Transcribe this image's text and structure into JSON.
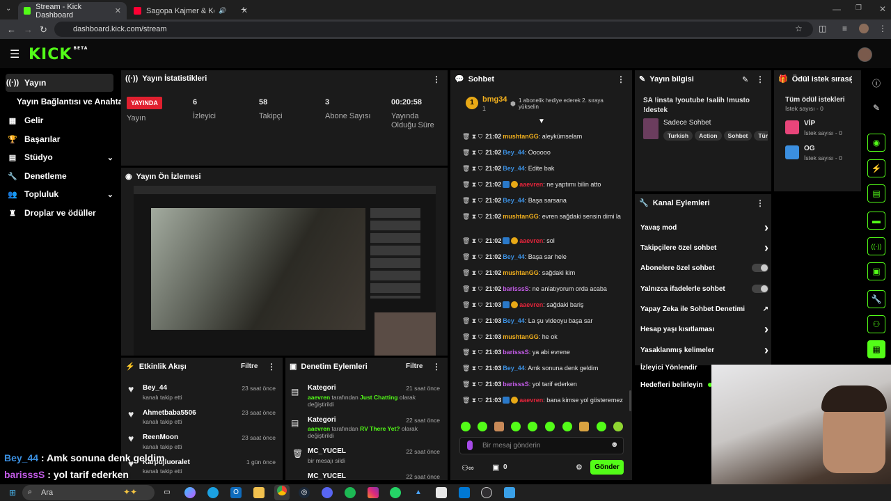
{
  "browser": {
    "tabs": [
      {
        "label": "Stream - Kick Dashboard",
        "active": true
      },
      {
        "label": "Sagopa Kajmer & Kolera - Ne",
        "active": false
      }
    ],
    "url": "dashboard.kick.com/stream"
  },
  "sidebar": {
    "items": [
      {
        "label": "Yayın",
        "icon": "broadcast-icon"
      },
      {
        "label": "Yayın Bağlantısı ve Anahtarı"
      },
      {
        "label": "Gelir",
        "icon": "revenue-icon"
      },
      {
        "label": "Başarılar",
        "icon": "trophy-icon"
      },
      {
        "label": "Stüdyo",
        "icon": "studio-icon"
      },
      {
        "label": "Denetleme",
        "icon": "wrench-icon"
      },
      {
        "label": "Topluluk",
        "icon": "community-icon"
      },
      {
        "label": "Droplar ve ödüller",
        "icon": "drops-icon"
      }
    ]
  },
  "stats": {
    "title": "Yayın İstatistikleri",
    "live_badge": "YAYINDA",
    "live_label": "Yayın",
    "items": [
      {
        "value": "6",
        "label": "İzleyici"
      },
      {
        "value": "58",
        "label": "Takipçi"
      },
      {
        "value": "3",
        "label": "Abone Sayısı"
      },
      {
        "value": "00:20:58",
        "label": "Yayında Olduğu Süre"
      }
    ]
  },
  "preview": {
    "title": "Yayın Ön İzlemesi"
  },
  "activity": {
    "title": "Etkinlik Akışı",
    "filter": "Filtre",
    "items": [
      {
        "name": "Bey_44",
        "sub": "kanalı takip etti",
        "time": "23 saat önce"
      },
      {
        "name": "Ahmetbaba5506",
        "sub": "kanalı takip etti",
        "time": "23 saat önce"
      },
      {
        "name": "ReenMoon",
        "sub": "kanalı takip etti",
        "time": "23 saat önce"
      },
      {
        "name": "Karpujluoralet",
        "sub": "kanalı takip etti",
        "time": "1 gün önce"
      }
    ]
  },
  "moderation": {
    "title": "Denetim Eylemleri",
    "filter": "Filtre",
    "items": [
      {
        "title": "Kategori",
        "time": "21 saat önce",
        "user": "aaevren",
        "mid": " tarafından ",
        "cat": "Just Chatting",
        "end": " olarak değiştirildi"
      },
      {
        "title": "Kategori",
        "time": "22 saat önce",
        "user": "aaevren",
        "mid": " tarafından ",
        "cat": "RV There Yet?",
        "end": " olarak değiştirildi"
      },
      {
        "title": "MC_YUCEL",
        "time": "22 saat önce",
        "sub": "bir mesajı sildi"
      },
      {
        "title": "MC_YUCEL",
        "time": "22 saat önce"
      }
    ]
  },
  "chat": {
    "title": "Sohbet",
    "pinned_user": "bmg34",
    "pinned_count": "1",
    "pinned_badge": "1",
    "gift_text": "1 abonelik hediye ederek 2. sıraya yükselin",
    "messages": [
      {
        "time": "21:02",
        "user": "mushtanGG",
        "color": "#f2b01e",
        "text": "aleykümselam"
      },
      {
        "time": "21:02",
        "user": "Bey_44",
        "color": "#3b8fe0",
        "text": "Oooooo"
      },
      {
        "time": "21:02",
        "user": "Bey_44",
        "color": "#3b8fe0",
        "text": "Edite bak"
      },
      {
        "time": "21:02",
        "user": "aaevren",
        "color": "#e5243b",
        "text": "ne yaptımı bilin atto",
        "badges": true
      },
      {
        "time": "21:02",
        "user": "Bey_44",
        "color": "#3b8fe0",
        "text": "Başa sarsana"
      },
      {
        "time": "21:02",
        "user": "mushtanGG",
        "color": "#f2b01e",
        "text": "evren sağdaki sensin dimi la"
      },
      {
        "time": "21:02",
        "user": "aaevren",
        "color": "#e5243b",
        "text": "sol",
        "badges": true
      },
      {
        "time": "21:02",
        "user": "Bey_44",
        "color": "#3b8fe0",
        "text": "Başa sar hele"
      },
      {
        "time": "21:02",
        "user": "mushtanGG",
        "color": "#f2b01e",
        "text": "sağdaki kim"
      },
      {
        "time": "21:02",
        "user": "barisssS",
        "color": "#c45ce8",
        "text": "ne anlatıyorum orda acaba"
      },
      {
        "time": "21:03",
        "user": "aaevren",
        "color": "#e5243b",
        "text": "sağdaki bariş",
        "badges": true
      },
      {
        "time": "21:03",
        "user": "Bey_44",
        "color": "#3b8fe0",
        "text": "La şu videoyu başa sar"
      },
      {
        "time": "21:03",
        "user": "mushtanGG",
        "color": "#f2b01e",
        "text": "he ok"
      },
      {
        "time": "21:03",
        "user": "barisssS",
        "color": "#c45ce8",
        "text": "ya abi evrene"
      },
      {
        "time": "21:03",
        "user": "Bey_44",
        "color": "#3b8fe0",
        "text": "Amk sonuna denk geldim"
      },
      {
        "time": "21:03",
        "user": "barisssS",
        "color": "#c45ce8",
        "text": "yol tarif ederken"
      },
      {
        "time": "21:03",
        "user": "aaevren",
        "color": "#e5243b",
        "text": "bana kimse yol gösteremez",
        "badges": true
      }
    ],
    "input_placeholder": "Bir mesaj gönderin",
    "send_label": "Gönder",
    "points": "0"
  },
  "info": {
    "title": "Yayın bilgisi",
    "stream_title": "SA !insta !youtube !salih !musto !destek",
    "category": "Sadece Sohbet",
    "tags": [
      "Turkish",
      "Action",
      "Sohbet",
      "Tür"
    ]
  },
  "rewards": {
    "title": "Ödül istek sırası",
    "all": "Tüm ödül istekleri",
    "all_count": "İstek sayısı - 0",
    "items": [
      {
        "name": "VİP",
        "count": "İstek sayısı - 0",
        "color": "#e8457a"
      },
      {
        "name": "OG",
        "count": "İstek sayısı - 0",
        "color": "#3b8fe0"
      }
    ]
  },
  "channel_actions": {
    "title": "Kanal Eylemleri",
    "items": [
      {
        "label": "Yavaş mod",
        "kind": "arrow"
      },
      {
        "label": "Takipçilere özel sohbet",
        "kind": "arrow"
      },
      {
        "label": "Abonelere özel sohbet",
        "kind": "toggle"
      },
      {
        "label": "Yalnızca ifadelerle sohbet",
        "kind": "toggle"
      },
      {
        "label": "Yapay Zeka ile Sohbet Denetimi",
        "kind": "ext"
      },
      {
        "label": "Hesap yaşı kısıtlaması",
        "kind": "arrow"
      },
      {
        "label": "Yasaklanmış kelimeler",
        "kind": "arrow"
      },
      {
        "label": "İzleyici Yönlendir",
        "kind": "none"
      },
      {
        "label": "Hedefleri belirleyin",
        "kind": "dot"
      }
    ]
  },
  "overlay": {
    "line1_user": "Bey_44",
    "line1_text": " : Amk sonuna denk geldim",
    "line2_user": "barisssS",
    "line2_text": " : yol tarif ederken"
  },
  "taskbar": {
    "search": "Ara"
  }
}
